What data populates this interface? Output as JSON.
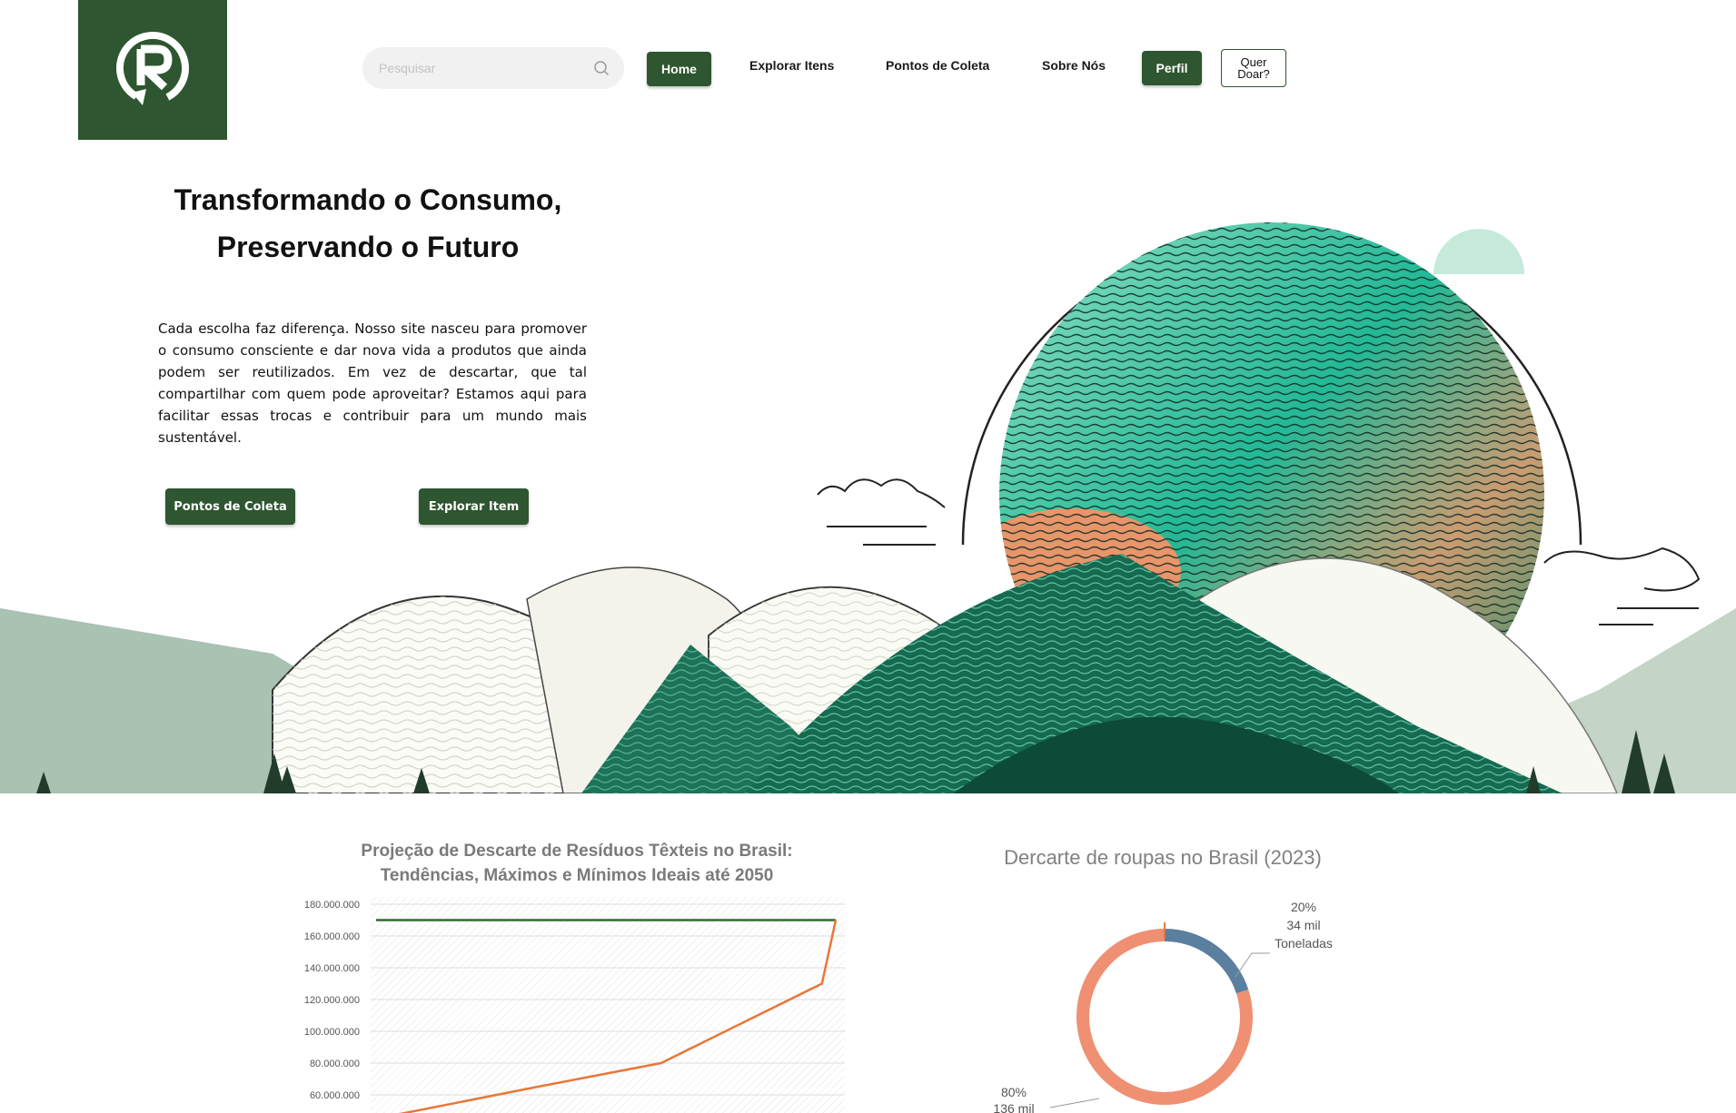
{
  "header": {
    "logo_alt": "R",
    "search": {
      "placeholder": "Pesquisar",
      "value": ""
    },
    "nav": {
      "home": "Home",
      "explorar_itens": "Explorar Itens",
      "pontos_coleta": "Pontos de Coleta",
      "sobre_nos": "Sobre Nós",
      "perfil": "Perfil",
      "quer_doar_1": "Quer",
      "quer_doar_2": "Doar?"
    },
    "brand_color": "#2e5630"
  },
  "hero": {
    "title_line1": "Transformando o Consumo,",
    "title_line2": "Preservando o Futuro",
    "text": "Cada escolha faz diferença. Nosso site nasceu para promover o consumo consciente e dar nova vida a produtos que ainda podem ser reutilizados. Em vez de descartar, que tal compartilhar com quem pode aproveitar? Estamos aqui para facilitar essas trocas e contribuir para um mundo mais sustentável.",
    "btn_pontos": "Pontos de Coleta",
    "btn_explorar": "Explorar Item"
  },
  "chart_data": [
    {
      "type": "line",
      "title": "Projeção de Descarte de Resíduos Têxteis no Brasil: Tendências, Máximos e Mínimos Ideais até 2050",
      "title_line1": "Projeção de Descarte de Resíduos Têxteis no Brasil:",
      "title_line2": "Tendências, Máximos e Mínimos Ideais até 2050",
      "ylim": [
        0,
        180000000
      ],
      "visible_ylim": [
        60000000,
        180000000
      ],
      "y_ticks": [
        "180.000.000",
        "160.000.000",
        "140.000.000",
        "120.000.000",
        "100.000.000",
        "80.000.000",
        "60.000.000"
      ],
      "grid": true,
      "series": [
        {
          "color": "#2e6b2e",
          "x": [
            0,
            1
          ],
          "values": [
            170000000,
            170000000
          ]
        },
        {
          "color": "#e8773a",
          "x": [
            0,
            0.35,
            0.62,
            0.97,
            1
          ],
          "values": [
            45000000,
            65000000,
            80000000,
            130000000,
            170000000
          ]
        }
      ]
    },
    {
      "type": "pie",
      "title": "Dercarte de roupas no Brasil (2023)",
      "slices": [
        {
          "percent": 20,
          "label_pct": "20%",
          "label_1": "34 mil",
          "label_2": "Toneladas",
          "color": "#5b7f9e"
        },
        {
          "percent": 80,
          "label_pct": "80%",
          "label_1": "136 mil",
          "color": "#ef9072"
        }
      ]
    }
  ]
}
